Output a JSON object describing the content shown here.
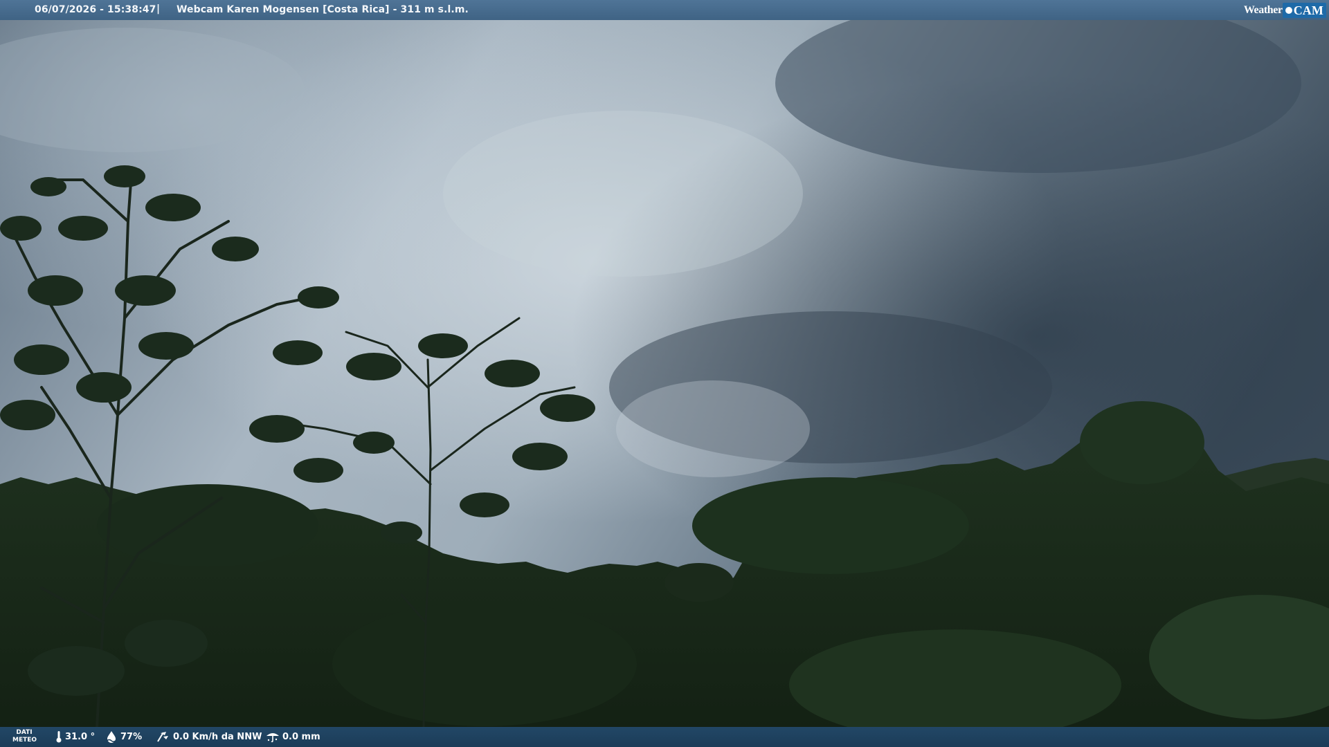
{
  "overlay": {
    "datetime": "06/07/2026 - 15:38:47",
    "separator": "|",
    "title": "Webcam Karen Mogensen [Costa Rica] - 311 m s.l.m.",
    "logo_left": "Weather",
    "logo_right": "CAM"
  },
  "weather": {
    "section_label_line1": "DATI",
    "section_label_line2": "METEO",
    "temperature": "31.0 °",
    "humidity": "77%",
    "wind": "0.0 Km/h da NNW",
    "rain": "0.0 mm",
    "icons": [
      "thermometer-icon",
      "humidity-icon",
      "wind-icon",
      "rain-icon"
    ]
  },
  "scene": {
    "description_colors": {
      "sky_light": "#c0cbd4",
      "sky_dark": "#3a4a59",
      "canopy": "#1c2e1d"
    }
  }
}
